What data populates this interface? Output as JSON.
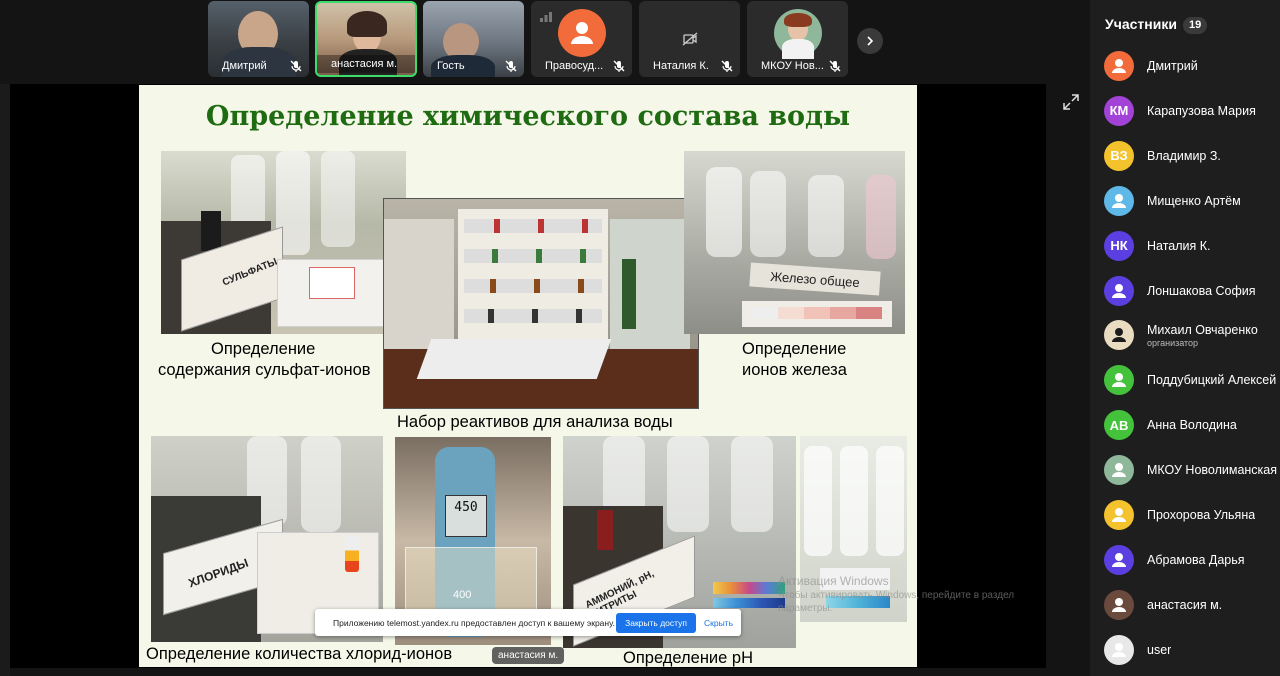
{
  "tiles": [
    {
      "name": "Дмитрий"
    },
    {
      "name": "анастасия м."
    },
    {
      "name": "Гость"
    },
    {
      "name": "Правосуд..."
    },
    {
      "name": "Наталия К."
    },
    {
      "name": "МКОУ Нов..."
    }
  ],
  "slide": {
    "title": "Определение химического состава воды",
    "captions": {
      "sulfate_line1": "Определение",
      "sulfate_line2": "содержания сульфат-ионов",
      "iron_line1": "Определение",
      "iron_line2": "ионов железа",
      "kit": "Набор реактивов для анализа воды",
      "chloride": "Определение количества хлорид-ионов",
      "ph": "Определение pH"
    },
    "photo_text": {
      "sulfate_box": "СУЛЬФАТЫ",
      "iron_strip": "Железо общее",
      "chloride_box": "ХЛОРИДЫ",
      "ph_meter_value": "450",
      "ph_meter_unit": "400",
      "ammonium_box": "АММОНИЙ, pH, НИТРИТЫ"
    }
  },
  "notice": {
    "text": "Приложению telemost.yandex.ru предоставлен доступ к вашему экрану.",
    "stop_label": "Закрыть доступ",
    "hide_label": "Скрыть"
  },
  "speaker_tag": "анастасия м.",
  "watermark": {
    "line1": "Активация Windows",
    "line2": "Чтобы активировать Windows, перейдите в раздел",
    "line3": "параметры."
  },
  "panel": {
    "title": "Участники",
    "count": "19",
    "participants": [
      {
        "name": "Дмитрий",
        "initials": "",
        "color": "#f26b3a"
      },
      {
        "name": "Карапузова Мария",
        "initials": "КМ",
        "color": "#a342d6"
      },
      {
        "name": "Владимир З.",
        "initials": "ВЗ",
        "color": "#f3c22c"
      },
      {
        "name": "Мищенко Артём",
        "initials": "",
        "color": "#5fb9e8"
      },
      {
        "name": "Наталия К.",
        "initials": "НК",
        "color": "#5b3fe0"
      },
      {
        "name": "Лоншакова София",
        "initials": "",
        "color": "#5b3fe0"
      },
      {
        "name": "Михаил Овчаренко",
        "role": "организатор",
        "initials": "",
        "color": "#e9dcc1"
      },
      {
        "name": "Поддубицкий Алексей",
        "initials": "",
        "color": "#45c23c"
      },
      {
        "name": "Анна Володина",
        "initials": "АВ",
        "color": "#45c23c"
      },
      {
        "name": "МКОУ Новолиманская СОШ",
        "initials": "",
        "color": "#8fb79a"
      },
      {
        "name": "Прохорова Ульяна",
        "initials": "",
        "color": "#f3c22c"
      },
      {
        "name": "Абрамова Дарья",
        "initials": "",
        "color": "#5b3fe0"
      },
      {
        "name": "анастасия м.",
        "initials": "",
        "color": "#6b4a3e"
      },
      {
        "name": "user",
        "initials": "",
        "color": "#e8e8e8"
      }
    ]
  },
  "colors": {
    "accent_active_speaker": "#3ddc6a",
    "slide_title": "#1f6b12",
    "button_primary": "#1a73e8"
  }
}
